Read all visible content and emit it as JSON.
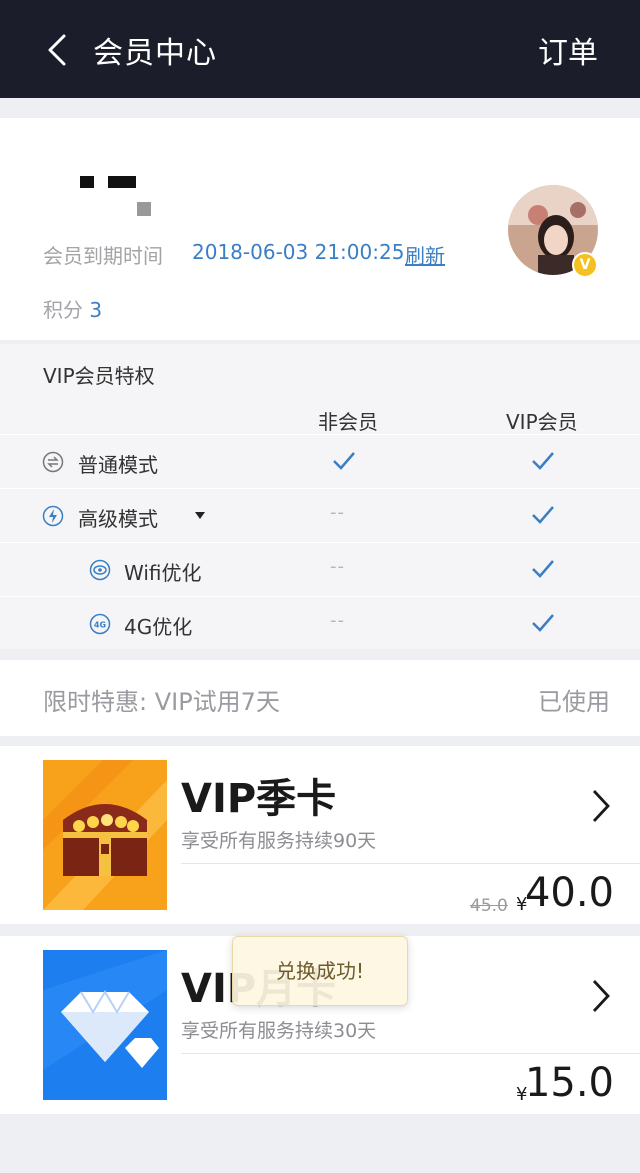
{
  "header": {
    "title": "会员中心",
    "orders_label": "订单"
  },
  "profile": {
    "expiry_label": "会员到期时间",
    "expiry_value": "2018-06-03 21:00:25",
    "refresh_label": "刷新",
    "points_label": "积分",
    "points_value": "3",
    "badge": "V"
  },
  "privileges": {
    "title": "VIP会员特权",
    "columns": [
      "非会员",
      "VIP会员"
    ],
    "rows": [
      {
        "label": "普通模式",
        "icon": "swap-icon",
        "non_member": "check",
        "vip": "check"
      },
      {
        "label": "高级模式",
        "icon": "lightning-icon",
        "non_member": "--",
        "vip": "check",
        "expandable": true
      },
      {
        "label": "Wifi优化",
        "icon": "eye-icon",
        "non_member": "--",
        "vip": "check"
      },
      {
        "label": "4G优化",
        "icon": "4g-icon",
        "non_member": "--",
        "vip": "check"
      }
    ]
  },
  "offer": {
    "label": "限时特惠: VIP试用7天",
    "status": "已使用"
  },
  "plans": [
    {
      "name": "VIP季卡",
      "desc": "享受所有服务持续90天",
      "old_price": "45.0",
      "currency": "¥",
      "price": "40.0"
    },
    {
      "name": "VIP月卡",
      "desc": "享受所有服务持续30天",
      "currency": "¥",
      "price": "15.0"
    }
  ],
  "toast": "兑换成功!",
  "colors": {
    "header_bg": "#1b1d2a",
    "accent": "#3a7fc4",
    "badge": "#f4c11f"
  }
}
